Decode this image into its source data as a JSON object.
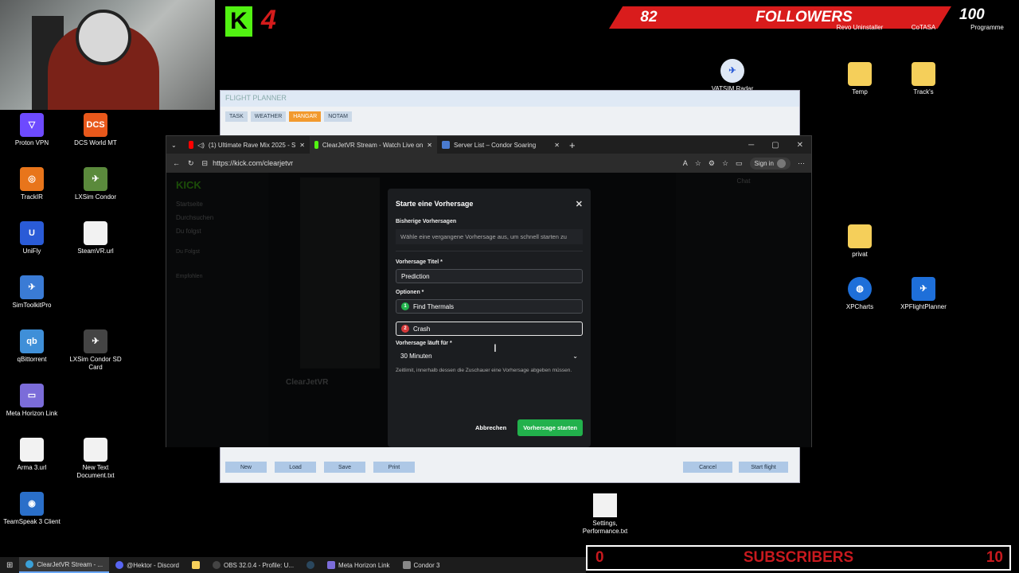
{
  "overlay": {
    "kick_logo": "K",
    "kick_count": "4",
    "followers_count": "82",
    "followers_label": "FOLLOWERS",
    "followers_goal": "100",
    "subscribers_count": "0",
    "subscribers_label": "SUBSCRIBERS",
    "subscribers_goal": "10"
  },
  "desktop_icons_left": [
    {
      "label": "Proton VPN",
      "color": "#6d4aff",
      "glyph": "▽"
    },
    {
      "label": "DCS World MT",
      "color": "#e8581b",
      "glyph": "DCS"
    },
    {
      "label": "TrackIR",
      "color": "#e8751b",
      "glyph": "◎"
    },
    {
      "label": "LXSim Condor",
      "color": "#5b8a3c",
      "glyph": "✈"
    },
    {
      "label": "UniFly",
      "color": "#2a5bd7",
      "glyph": "U"
    },
    {
      "label": "SteamVR.url",
      "color": "#f2f2f2",
      "glyph": ""
    },
    {
      "label": "SimToolkitPro",
      "color": "#3a7bd5",
      "glyph": "✈"
    },
    {
      "label": "qBittorrent",
      "color": "#3f8fd8",
      "glyph": "qb"
    },
    {
      "label": "LXSim Condor SD Card",
      "color": "#444",
      "glyph": "✈"
    },
    {
      "label": "Meta Horizon Link",
      "color": "#7b6cd9",
      "glyph": "▭"
    },
    {
      "label": "Arma 3.url",
      "color": "#f2f2f2",
      "glyph": ""
    },
    {
      "label": "New Text Document.txt",
      "color": "#f2f2f2",
      "glyph": ""
    },
    {
      "label": "TeamSpeak 3 Client",
      "color": "#2a6fc9",
      "glyph": "◉"
    }
  ],
  "desktop_icons_right": [
    {
      "label": "Revo Uninstaller"
    },
    {
      "label": "CoTASA"
    },
    {
      "label": "Programme"
    },
    {
      "label": "VATSIM Radar"
    },
    {
      "label": "Temp"
    },
    {
      "label": "Track's"
    },
    {
      "label": "privat"
    },
    {
      "label": "XPCharts"
    },
    {
      "label": "XPFlightPlanner"
    },
    {
      "label": "Settings, Performance.txt"
    }
  ],
  "flight_planner": {
    "title": "FLIGHT PLANNER",
    "tabs": [
      "TASK",
      "WEATHER",
      "HANGAR",
      "NOTAM"
    ],
    "active_tab": "HANGAR",
    "buttons_left": [
      "New",
      "Load",
      "Save",
      "Print"
    ],
    "buttons_right": [
      "Cancel",
      "Start flight"
    ]
  },
  "browser": {
    "tabs": [
      {
        "title": "(1) Ultimate Rave Mix 2025 - S",
        "color": "#ff0000"
      },
      {
        "title": "ClearJetVR Stream - Watch Live on",
        "color": "#52f212"
      },
      {
        "title": "Server List – Condor Soaring",
        "color": "#4a7bd0"
      }
    ],
    "url": "https://kick.com/clearjetvr",
    "sign_in": "Sign in",
    "kick_sidebar": [
      "Startseite",
      "Durchsuchen",
      "Du folgst"
    ],
    "kick_sidebar_following": "Du Folgst",
    "kick_sidebar_recommended": "Empfohlen",
    "kick_channel": "ClearJetVR",
    "chat_title": "Chat"
  },
  "modal": {
    "title": "Starte eine Vorhersage",
    "prev_label": "Bisherige Vorhersagen",
    "prev_hint": "Wähle eine vergangene Vorhersage aus, um schnell starten zu",
    "title_label": "Vorhersage Titel *",
    "title_value": "Prediction",
    "options_label": "Optionen *",
    "option1": "Find Thermals",
    "option2": "Crash",
    "duration_label": "Vorhersage läuft für *",
    "duration_value": "30 Minuten",
    "help": "Zeitlimit, innerhalb dessen die Zuschauer eine Vorhersage abgeben müssen.",
    "cancel": "Abbrechen",
    "start": "Vorhersage starten"
  },
  "taskbar": [
    {
      "label": "ClearJetVR Stream - ...",
      "active": true
    },
    {
      "label": "@Hektor - Discord",
      "active": false
    },
    {
      "label": "",
      "active": false
    },
    {
      "label": "OBS 32.0.4 - Profile: U...",
      "active": false
    },
    {
      "label": "",
      "active": false
    },
    {
      "label": "Meta Horizon Link",
      "active": false
    },
    {
      "label": "Condor 3",
      "active": false
    }
  ]
}
